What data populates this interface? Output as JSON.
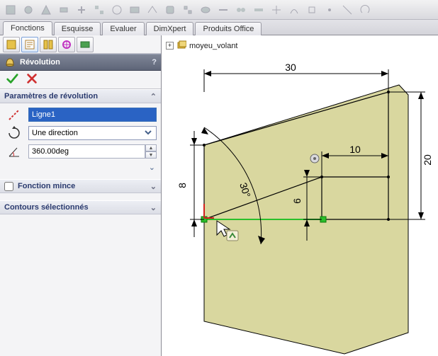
{
  "tabs": {
    "items": [
      "Fonctions",
      "Esquisse",
      "Evaluer",
      "DimXpert",
      "Produits Office"
    ],
    "active_index": 0
  },
  "feature": {
    "title": "Révolution",
    "help": "?"
  },
  "params": {
    "header": "Paramètres de révolution",
    "axis_field_value": "Ligne1",
    "direction_label": "Une direction",
    "angle_value": "360.00deg"
  },
  "thin": {
    "header": "Fonction mince",
    "checked": false
  },
  "contours": {
    "header": "Contours sélectionnés"
  },
  "tree": {
    "root_label": "moyeu_volant"
  },
  "dimensions": {
    "top_width": "30",
    "right_height": "20",
    "shelf_width": "10",
    "left_height": "8",
    "inner_height": "6",
    "angle": "30°"
  },
  "chart_data": {
    "type": "diagram",
    "title": "Revolved boss sketch profile",
    "units": "mm",
    "profile_points": [
      {
        "x": 0,
        "y": 0
      },
      {
        "x": 0,
        "y": 8
      },
      {
        "x": 30,
        "y": 20,
        "via": "line at 30° from vertical"
      },
      {
        "x": 30,
        "y": 0
      },
      {
        "x": 20,
        "y": 0
      },
      {
        "x": 20,
        "y": 6
      },
      {
        "x": 0,
        "y": 6,
        "via": "axis / inner edge"
      }
    ],
    "dimensions": {
      "overall_width": 30,
      "overall_right_height": 20,
      "left_height": 8,
      "shelf_width": 10,
      "shelf_height": 6,
      "top_slope_angle_deg": 30
    },
    "revolve": {
      "axis": "Ligne1",
      "angle_deg": 360,
      "direction": "Une direction"
    }
  }
}
